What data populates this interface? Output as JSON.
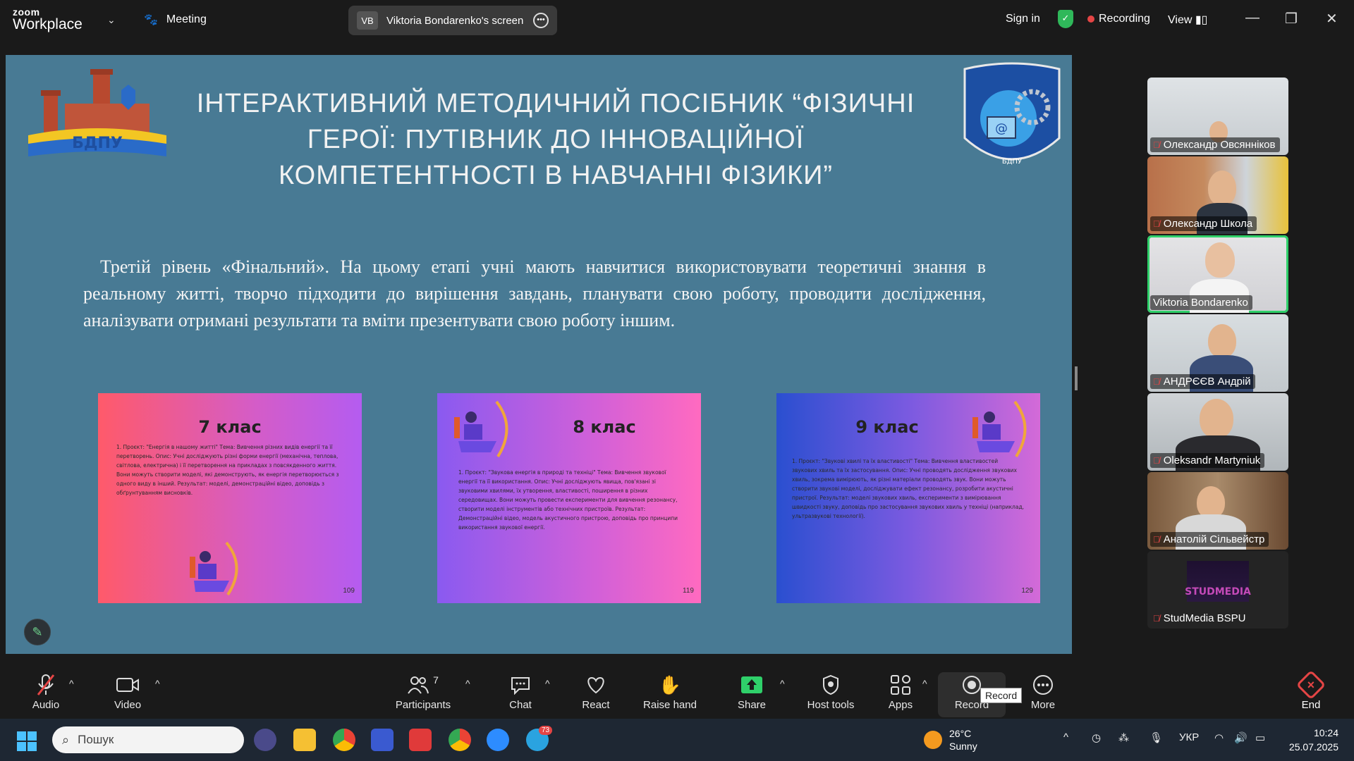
{
  "topbar": {
    "brand_small": "zoom",
    "brand_large": "Workplace",
    "meeting_label": "Meeting",
    "share_initials": "VB",
    "share_label": "Viktoria Bondarenko's screen",
    "sign_in": "Sign in",
    "recording": "Recording",
    "view": "View"
  },
  "slide": {
    "title": "ІНТЕРАКТИВНИЙ МЕТОДИЧНИЙ ПОСІБНИК “ФІЗИЧНІ ГЕРОЇ: ПУТІВНИК ДО ІННОВАЦІЙНОЇ КОМПЕТЕНТНОСТІ В НАВЧАННІ ФІЗИКИ”",
    "body": "Третій рівень «Фінальний». На цьому етапі учні мають навчитися використовувати теоретичні знання в реальному житті, творчо підходити до вирішення завдань, планувати свою роботу, проводити дослідження, аналізувати отримані результати та вміти презентувати свою роботу іншим.",
    "logo_left_text": "БДПУ",
    "logo_right_text": "БДПУ",
    "cards": [
      {
        "title": "7 клас",
        "page": "109",
        "text": "1. Проєкт: \"Енергія в нашому житті\" Тема: Вивчення різних видів енергії та її перетворень. Опис: Учні досліджують різні форми енергії (механічна, теплова, світлова, електрична) і її перетворення на прикладах з повсякденного життя. Вони можуть створити моделі, які демонструють, як енергія перетворюється з одного виду в інший. Результат: моделі, демонстраційні відео, доповідь з обґрунтуванням висновків."
      },
      {
        "title": "8 клас",
        "page": "119",
        "text": "1. Проєкт: \"Звукова енергія в природі та техніці\" Тема: Вивчення звукової енергії та її використання. Опис: Учні досліджують явища, пов'язані зі звуковими хвилями, їх утворення, властивості, поширення в різних середовищах. Вони можуть провести експерименти для вивчення резонансу, створити моделі інструментів або технічних пристроїв. Результат: Демонстраційні відео, модель акустичного пристрою, доповідь про принципи використання звукової енергії."
      },
      {
        "title": "9 клас",
        "page": "129",
        "text": "1. Проєкт: \"Звукові хвилі та їх властивості\" Тема: Вивчення властивостей звукових хвиль та їх застосування. Опис: Учні проводять дослідження звукових хвиль, зокрема вимірюють, як різні матеріали проводять звук. Вони можуть створити звукові моделі, досліджувати ефект резонансу, розробити акустичні пристрої. Результат: моделі звукових хвиль, експерименти з вимірювання швидкості звуку, доповідь про застосування звукових хвиль у техніці (наприклад, ультразвукові технології)."
      }
    ]
  },
  "participants": [
    {
      "name": "Олександр Овсянніков",
      "muted": true
    },
    {
      "name": "Олександр Школа",
      "muted": true
    },
    {
      "name": "Viktoria Bondarenko",
      "muted": false
    },
    {
      "name": "АНДРЄЄВ Андрій",
      "muted": true
    },
    {
      "name": "Oleksandr Martyniuk",
      "muted": true
    },
    {
      "name": "Анатолій Сільвейстр",
      "muted": true
    },
    {
      "name": "StudMedia BSPU",
      "muted": true,
      "logo_text": "STUDMEDIA"
    }
  ],
  "toolbar": {
    "audio": "Audio",
    "video": "Video",
    "participants": "Participants",
    "participants_count": "7",
    "chat": "Chat",
    "react": "React",
    "raise_hand": "Raise hand",
    "share": "Share",
    "host_tools": "Host tools",
    "apps": "Apps",
    "record": "Record",
    "record_tooltip": "Record",
    "more": "More",
    "end": "End"
  },
  "taskbar": {
    "search_placeholder": "Пошук",
    "telegram_badge": "73",
    "temperature": "26°C",
    "weather": "Sunny",
    "language": "УКР",
    "time": "10:24",
    "date": "25.07.2025"
  },
  "colors": {
    "slide_bg": "#487a94",
    "recording_dot": "#e54545",
    "active_speaker": "#2fd06a",
    "share_green": "#2fb85a"
  }
}
